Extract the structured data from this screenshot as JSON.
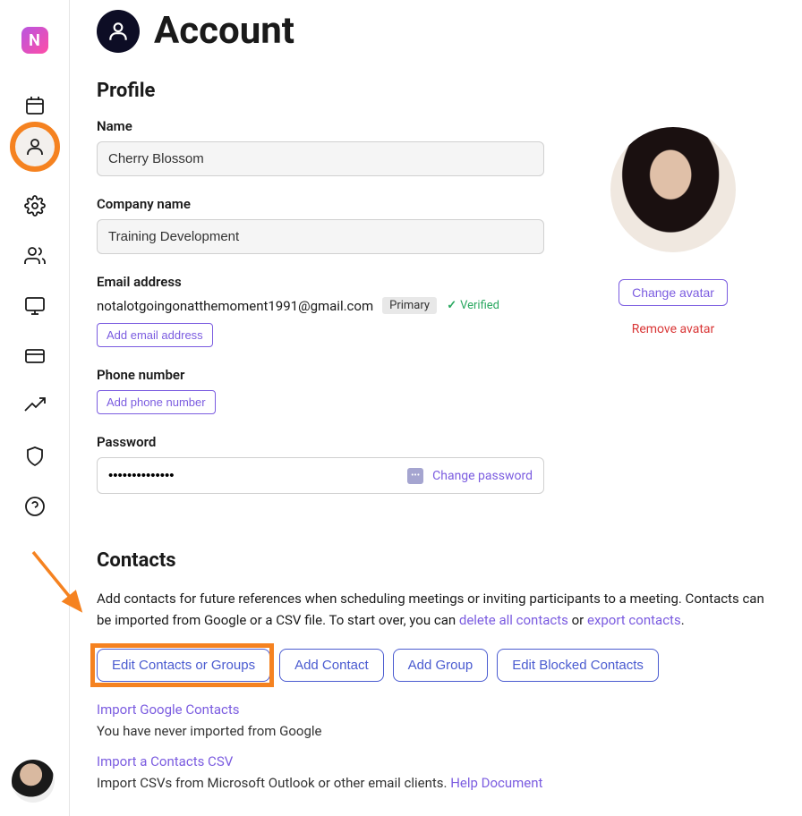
{
  "header": {
    "title": "Account"
  },
  "profile": {
    "section_title": "Profile",
    "name_label": "Name",
    "name_value": "Cherry Blossom",
    "company_label": "Company name",
    "company_value": "Training Development",
    "email_label": "Email address",
    "email_value": "notalotgoingonatthemoment1991@gmail.com",
    "email_primary_badge": "Primary",
    "email_verified_text": "Verified",
    "add_email_btn": "Add email address",
    "phone_label": "Phone number",
    "add_phone_btn": "Add phone number",
    "password_label": "Password",
    "password_dots": "••••••••••••••",
    "change_password_link": "Change password",
    "change_avatar_btn": "Change avatar",
    "remove_avatar_link": "Remove avatar"
  },
  "contacts": {
    "section_title": "Contacts",
    "description_1": "Add contacts for future references when scheduling meetings or inviting participants to a meeting. Contacts can be imported from Google or a CSV file. To start over, you can ",
    "delete_link": "delete all contacts",
    "or_text": " or ",
    "export_link": "export contacts",
    "period": ".",
    "btn_edit_contacts": "Edit Contacts or Groups",
    "btn_add_contact": "Add Contact",
    "btn_add_group": "Add Group",
    "btn_edit_blocked": "Edit Blocked Contacts",
    "import_google_link": "Import Google Contacts",
    "import_google_sub": "You have never imported from Google",
    "import_csv_link": "Import a Contacts CSV",
    "import_csv_sub_1": "Import CSVs from Microsoft Outlook or other email clients. ",
    "help_doc_link": "Help Document"
  },
  "sidebar": {
    "logo": "N"
  }
}
